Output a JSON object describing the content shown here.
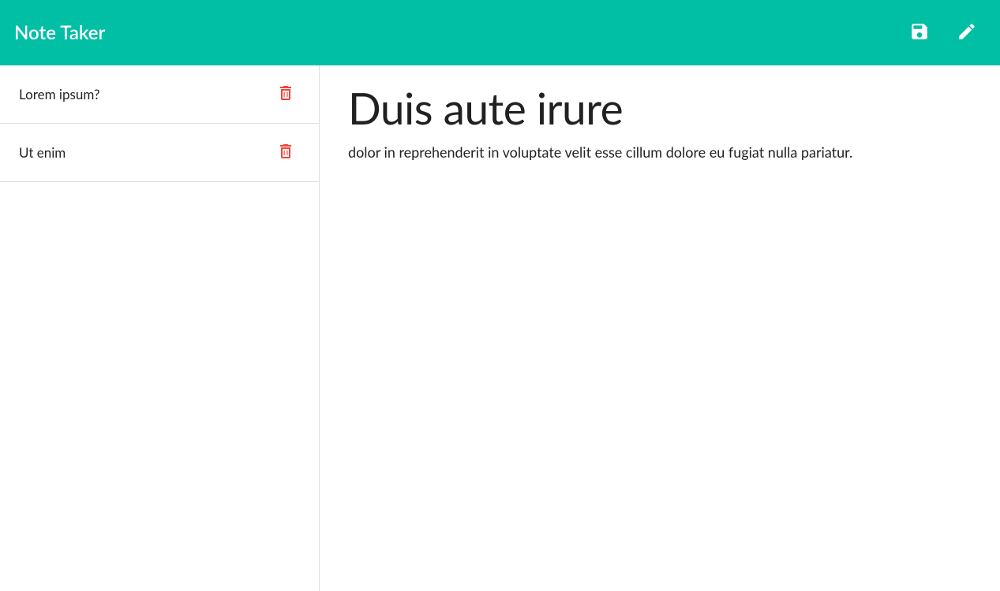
{
  "header": {
    "title": "Note Taker",
    "save_icon": "save-icon",
    "edit_icon": "pencil-icon"
  },
  "sidebar": {
    "items": [
      {
        "title": "Lorem ipsum?",
        "delete_icon": "delete-icon"
      },
      {
        "title": "Ut enim",
        "delete_icon": "delete-icon"
      }
    ]
  },
  "note": {
    "title": "Duis aute irure",
    "body": "dolor in reprehenderit in voluptate velit esse cillum dolore eu fugiat nulla pariatur."
  },
  "colors": {
    "accent": "#00bfa5",
    "danger": "#f44336"
  }
}
